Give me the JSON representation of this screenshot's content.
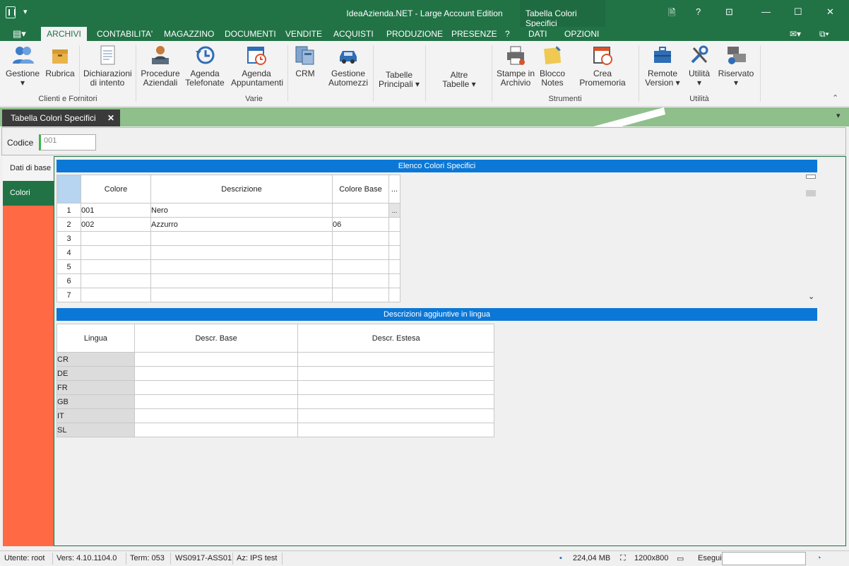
{
  "titlebar": {
    "title": "IdeaAzienda.NET - Large Account Edition",
    "context_title": "Tabella Colori Specifici",
    "help": "?"
  },
  "ribbon_tabs": [
    "ARCHIVI",
    "CONTABILITA'",
    "MAGAZZINO",
    "DOCUMENTI",
    "VENDITE",
    "ACQUISTI",
    "PRODUZIONE",
    "PRESENZE",
    "?",
    "DATI",
    "OPZIONI"
  ],
  "ribbon": {
    "buttons": [
      {
        "label": "Gestione",
        "icon": "users-icon"
      },
      {
        "label": "Rubrica",
        "icon": "box-icon"
      },
      {
        "label": "Dichiarazioni di intento",
        "icon": "document-icon"
      },
      {
        "label": "Procedure Aziendali",
        "icon": "person-desk-icon"
      },
      {
        "label": "Agenda Telefonate",
        "icon": "history-icon"
      },
      {
        "label": "Agenda Appuntamenti",
        "icon": "calendar-clock-icon"
      },
      {
        "label": "CRM",
        "icon": "crm-icon"
      },
      {
        "label": "Gestione Automezzi",
        "icon": "car-icon"
      },
      {
        "label": "Tabelle Principali",
        "icon": ""
      },
      {
        "label": "Altre Tabelle",
        "icon": ""
      },
      {
        "label": "Stampe in Archivio",
        "icon": "printer-icon"
      },
      {
        "label": "Blocco Notes",
        "icon": "notes-icon"
      },
      {
        "label": "Crea Promemoria",
        "icon": "calendar-reminder-icon"
      },
      {
        "label": "Remote Version",
        "icon": "briefcase-icon"
      },
      {
        "label": "Utilità",
        "icon": "tools-icon"
      },
      {
        "label": "Riservato",
        "icon": "gear-monitor-icon"
      }
    ],
    "groups": {
      "clienti": "Clienti e Fornitori",
      "varie": "Varie",
      "strumenti": "Strumenti",
      "utilita": "Utilità"
    }
  },
  "doc_tab": {
    "label": "Tabella Colori Specifici",
    "close": "✕"
  },
  "header": {
    "codice_label": "Codice",
    "codice_value": "001"
  },
  "side_tabs": {
    "dati_di_base": "Dati di base",
    "colori": "Colori"
  },
  "colori_grid": {
    "title": "Elenco Colori Specifici",
    "columns": [
      "Colore",
      "Descrizione",
      "Colore Base",
      "..."
    ],
    "rows": [
      {
        "n": "1",
        "colore": "001",
        "descrizione": "Nero",
        "base": ""
      },
      {
        "n": "2",
        "colore": "002",
        "descrizione": "Azzurro",
        "base": "06"
      },
      {
        "n": "3",
        "colore": "",
        "descrizione": "",
        "base": ""
      },
      {
        "n": "4",
        "colore": "",
        "descrizione": "",
        "base": ""
      },
      {
        "n": "5",
        "colore": "",
        "descrizione": "",
        "base": ""
      },
      {
        "n": "6",
        "colore": "",
        "descrizione": "",
        "base": ""
      },
      {
        "n": "7",
        "colore": "",
        "descrizione": "",
        "base": ""
      }
    ]
  },
  "lingua_grid": {
    "title": "Descrizioni aggiuntive in lingua",
    "columns": [
      "Lingua",
      "Descr. Base",
      "Descr. Estesa"
    ],
    "rows": [
      "CR",
      "DE",
      "FR",
      "GB",
      "IT",
      "SL"
    ]
  },
  "status": {
    "utente": "Utente: root",
    "vers": "Vers: 4.10.1104.0",
    "term": "Term: 053",
    "ws": "WS0917-ASS01",
    "az": "Az: IPS test",
    "mem": "224,04 MB",
    "res": "1200x800",
    "esegui": "Esegui"
  }
}
